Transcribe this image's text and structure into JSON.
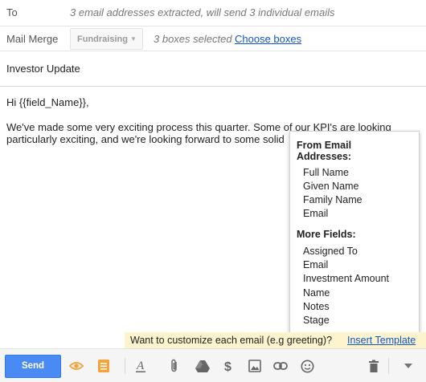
{
  "to": {
    "label": "To",
    "value": "3 email addresses extracted, will send 3 individual emails"
  },
  "mail_merge": {
    "label": "Mail Merge",
    "selected_option": "Fundraising",
    "boxes_selected": "3 boxes selected",
    "choose_boxes_link": "Choose boxes"
  },
  "subject": "Investor Update",
  "body": {
    "greeting": "Hi {{field_Name}},",
    "line1": "We've made some very exciting process this quarter. Some of our KPI's are looking",
    "line2": "particularly exciting, and we're looking forward to some solid"
  },
  "merge_fields_popup": {
    "section1_title_line1": "From Email",
    "section1_title_line2": "Addresses:",
    "section1_items": [
      "Full Name",
      "Given Name",
      "Family Name",
      "Email"
    ],
    "section2_title": "More Fields:",
    "section2_items": [
      "Assigned To",
      "Email",
      "Investment Amount",
      "Name",
      "Notes",
      "Stage"
    ]
  },
  "hint": {
    "text": "Want to customize each email (e.g greeting)?",
    "link": "Insert Template"
  },
  "toolbar": {
    "send_label": "Send",
    "icons": [
      "eye-icon",
      "template-icon",
      "text-format-icon",
      "attach-icon",
      "drive-icon",
      "dollar-icon",
      "photo-icon",
      "link-icon",
      "emoji-icon",
      "trash-icon",
      "more-options-icon"
    ]
  },
  "colors": {
    "send_button": "#4a8af4",
    "link": "#1155cc",
    "accent_orange": "#f4a23a",
    "hint_bar": "#fdf3cd"
  }
}
